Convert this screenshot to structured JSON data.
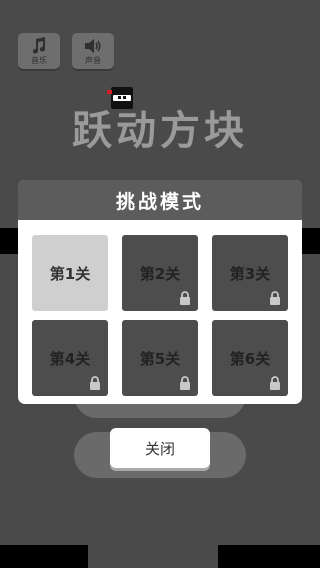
{
  "controls": {
    "music_label": "音乐",
    "sound_label": "声音"
  },
  "game_title": "跃动方块",
  "dialog": {
    "title": "挑战模式",
    "levels": [
      {
        "label": "第1关",
        "locked": false
      },
      {
        "label": "第2关",
        "locked": true
      },
      {
        "label": "第3关",
        "locked": true
      },
      {
        "label": "第4关",
        "locked": true
      },
      {
        "label": "第5关",
        "locked": true
      },
      {
        "label": "第6关",
        "locked": true
      }
    ]
  },
  "close_button": "关闭",
  "colors": {
    "background": "#4a4a4a",
    "dialog_header": "#5c5c5c",
    "level_locked": "#4d4d4d",
    "level_unlocked": "#cfcfcf",
    "title_gray": "#9a9a9a"
  }
}
